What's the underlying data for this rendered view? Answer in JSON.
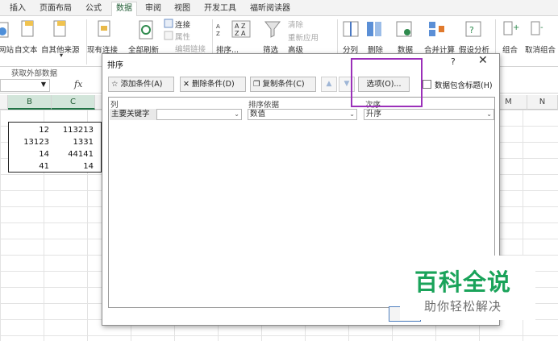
{
  "ribbon_tabs": [
    "插入",
    "页面布局",
    "公式",
    "数据",
    "审阅",
    "视图",
    "开发工具",
    "福昕阅读器"
  ],
  "active_tab": "数据",
  "ribbon": {
    "from_site": "网站",
    "from_text": "自文本",
    "from_other": "自其他来源",
    "existing": "现有连接",
    "refresh_all": "全部刷新",
    "connections": "连接",
    "properties": "属性",
    "edit_links": "编辑链接",
    "sort": "排序...",
    "filter": "筛选",
    "clear": "清除",
    "reapply": "重新应用",
    "advanced": "高级",
    "text_to_columns": "分列",
    "remove_dup": "删除",
    "data_validation": "数据",
    "consolidate": "合并计算",
    "what_if": "假设分析",
    "group": "组合",
    "ungroup": "取消组合",
    "group_label_external": "获取外部数据"
  },
  "name_box": "",
  "fx_label": "fx",
  "columns": [
    "B",
    "C",
    "M",
    "N"
  ],
  "cells": [
    [
      "12",
      "113213"
    ],
    [
      "13123",
      "1331"
    ],
    [
      "14",
      "44141"
    ],
    [
      "41",
      "14"
    ]
  ],
  "dialog": {
    "title": "排序",
    "help": "?",
    "close": "✕",
    "add_level": "添加条件(A)",
    "delete_level": "删除条件(D)",
    "copy_level": "复制条件(C)",
    "options": "选项(O)...",
    "has_headers": "数据包含标题(H)",
    "headers": {
      "column": "列",
      "sort_on": "排序依据",
      "order": "次序"
    },
    "row": {
      "label": "主要关键字",
      "column_value": "",
      "sort_on_value": "数值",
      "order_value": "升序"
    }
  },
  "watermark": {
    "title": "百科全说",
    "subtitle": "助你轻松解决"
  },
  "colors": {
    "accent": "#217346",
    "highlight": "#9b30b9",
    "watermark_green": "#1aa35a"
  }
}
